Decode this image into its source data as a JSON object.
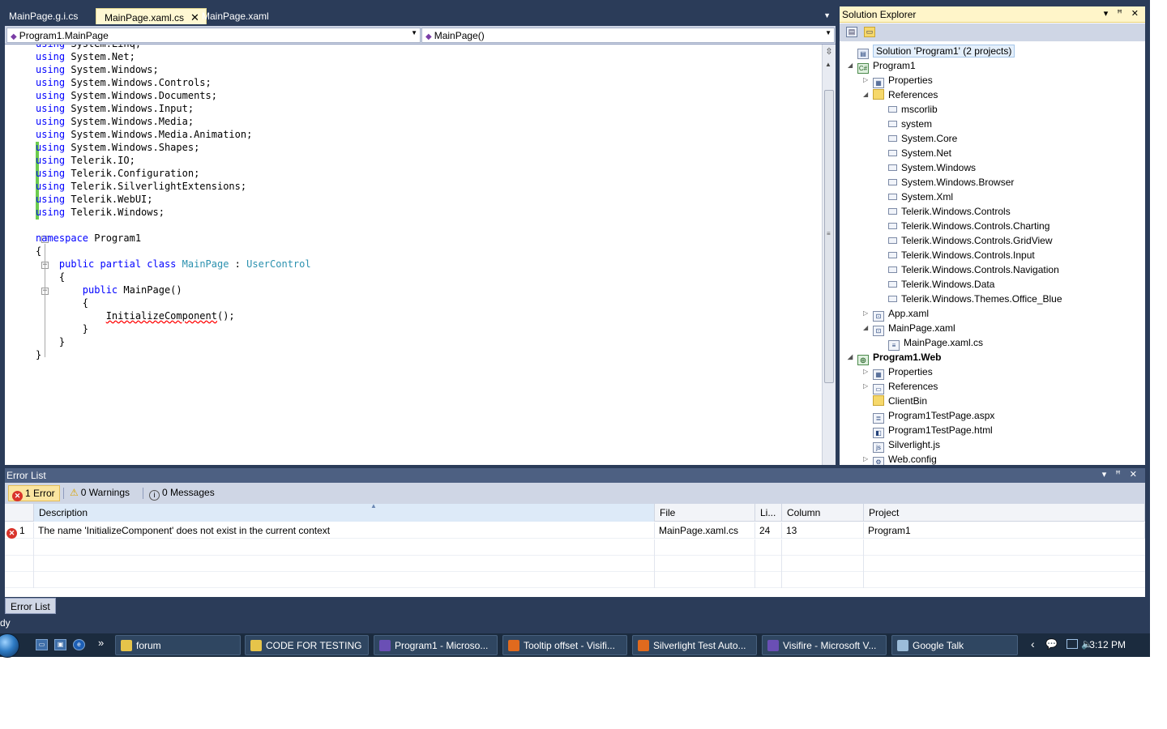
{
  "doc_tabs": [
    {
      "label": "MainPage.g.i.cs",
      "active": false
    },
    {
      "label": "MainPage.xaml.cs",
      "active": true
    },
    {
      "label": "MainPage.xaml",
      "active": false
    }
  ],
  "navbar": {
    "type_combo": "Program1.MainPage",
    "member_combo": "MainPage()"
  },
  "code_lines": [
    {
      "k": "using",
      "t": " System.Linq;"
    },
    {
      "k": "using",
      "t": " System.Net;"
    },
    {
      "k": "using",
      "t": " System.Windows;"
    },
    {
      "k": "using",
      "t": " System.Windows.Controls;"
    },
    {
      "k": "using",
      "t": " System.Windows.Documents;"
    },
    {
      "k": "using",
      "t": " System.Windows.Input;"
    },
    {
      "k": "using",
      "t": " System.Windows.Media;"
    },
    {
      "k": "using",
      "t": " System.Windows.Media.Animation;"
    },
    {
      "k": "using",
      "t": " System.Windows.Shapes;"
    },
    {
      "k": "using",
      "t": " Telerik.IO;"
    },
    {
      "k": "using",
      "t": " Telerik.Configuration;"
    },
    {
      "k": "using",
      "t": " Telerik.SilverlightExtensions;"
    },
    {
      "k": "using",
      "t": " Telerik.WebUI;"
    },
    {
      "k": "using",
      "t": " Telerik.Windows;"
    }
  ],
  "code_body": {
    "ns_kw": "namespace",
    "ns_name": " Program1",
    "brace_open": "{",
    "brace_close": "}",
    "class_kw": "public partial class",
    "class_name": "MainPage",
    "colon": " : ",
    "base_type": "UserControl",
    "ctor_kw": "public",
    "ctor_sig": " MainPage()",
    "call": "InitializeComponent",
    "call_tail": "();"
  },
  "solution_explorer": {
    "title": "Solution Explorer",
    "title_buttons": "▾ ꟸ ✕",
    "nodes": [
      {
        "label": "Solution 'Program1' (2 projects)",
        "icon": "solution-icon",
        "glyph": "▤",
        "exp": "",
        "depth": 0,
        "kind": "sol",
        "selected": true
      },
      {
        "label": "Program1",
        "icon": "csharp-project-icon",
        "glyph": "C#",
        "exp": "◢",
        "depth": 0,
        "kind": "proj"
      },
      {
        "label": "Properties",
        "icon": "properties-icon",
        "glyph": "▦",
        "exp": "▷",
        "depth": 1
      },
      {
        "label": "References",
        "icon": "references-folder-icon",
        "glyph": "",
        "exp": "◢",
        "depth": 1,
        "kind": "folder"
      },
      {
        "label": "mscorlib",
        "icon": "reference-icon",
        "glyph": "",
        "exp": "",
        "depth": 2,
        "kind": "ref"
      },
      {
        "label": "system",
        "icon": "reference-icon",
        "glyph": "",
        "exp": "",
        "depth": 2,
        "kind": "ref"
      },
      {
        "label": "System.Core",
        "icon": "reference-icon",
        "glyph": "",
        "exp": "",
        "depth": 2,
        "kind": "ref"
      },
      {
        "label": "System.Net",
        "icon": "reference-icon",
        "glyph": "",
        "exp": "",
        "depth": 2,
        "kind": "ref"
      },
      {
        "label": "System.Windows",
        "icon": "reference-icon",
        "glyph": "",
        "exp": "",
        "depth": 2,
        "kind": "ref"
      },
      {
        "label": "System.Windows.Browser",
        "icon": "reference-icon",
        "glyph": "",
        "exp": "",
        "depth": 2,
        "kind": "ref"
      },
      {
        "label": "System.Xml",
        "icon": "reference-icon",
        "glyph": "",
        "exp": "",
        "depth": 2,
        "kind": "ref"
      },
      {
        "label": "Telerik.Windows.Controls",
        "icon": "reference-icon",
        "glyph": "",
        "exp": "",
        "depth": 2,
        "kind": "ref"
      },
      {
        "label": "Telerik.Windows.Controls.Charting",
        "icon": "reference-icon",
        "glyph": "",
        "exp": "",
        "depth": 2,
        "kind": "ref"
      },
      {
        "label": "Telerik.Windows.Controls.GridView",
        "icon": "reference-icon",
        "glyph": "",
        "exp": "",
        "depth": 2,
        "kind": "ref"
      },
      {
        "label": "Telerik.Windows.Controls.Input",
        "icon": "reference-icon",
        "glyph": "",
        "exp": "",
        "depth": 2,
        "kind": "ref"
      },
      {
        "label": "Telerik.Windows.Controls.Navigation",
        "icon": "reference-icon",
        "glyph": "",
        "exp": "",
        "depth": 2,
        "kind": "ref"
      },
      {
        "label": "Telerik.Windows.Data",
        "icon": "reference-icon",
        "glyph": "",
        "exp": "",
        "depth": 2,
        "kind": "ref"
      },
      {
        "label": "Telerik.Windows.Themes.Office_Blue",
        "icon": "reference-icon",
        "glyph": "",
        "exp": "",
        "depth": 2,
        "kind": "ref"
      },
      {
        "label": "App.xaml",
        "icon": "xaml-file-icon",
        "glyph": "⊡",
        "exp": "▷",
        "depth": 1
      },
      {
        "label": "MainPage.xaml",
        "icon": "xaml-file-icon",
        "glyph": "⊡",
        "exp": "◢",
        "depth": 1
      },
      {
        "label": "MainPage.xaml.cs",
        "icon": "cs-file-icon",
        "glyph": "≡",
        "exp": "",
        "depth": 2
      },
      {
        "label": "Program1.Web",
        "icon": "web-project-icon",
        "glyph": "◎",
        "exp": "◢",
        "depth": 0,
        "kind": "proj",
        "bold": true
      },
      {
        "label": "Properties",
        "icon": "properties-icon",
        "glyph": "▦",
        "exp": "▷",
        "depth": 1
      },
      {
        "label": "References",
        "icon": "references-folder-icon",
        "glyph": "▭",
        "exp": "▷",
        "depth": 1
      },
      {
        "label": "ClientBin",
        "icon": "folder-icon",
        "glyph": "",
        "exp": "",
        "depth": 1,
        "kind": "folder"
      },
      {
        "label": "Program1TestPage.aspx",
        "icon": "aspx-file-icon",
        "glyph": "≣",
        "exp": "",
        "depth": 1
      },
      {
        "label": "Program1TestPage.html",
        "icon": "html-file-icon",
        "glyph": "◧",
        "exp": "",
        "depth": 1
      },
      {
        "label": "Silverlight.js",
        "icon": "js-file-icon",
        "glyph": "js",
        "exp": "",
        "depth": 1
      },
      {
        "label": "Web.config",
        "icon": "config-file-icon",
        "glyph": "⚙",
        "exp": "▷",
        "depth": 1
      }
    ]
  },
  "error_list": {
    "title": "Error List",
    "title_buttons": "▾ ꟸ ✕",
    "filters": {
      "errors": "1 Error",
      "warnings": "0 Warnings",
      "messages": "0 Messages"
    },
    "columns": [
      "Description",
      "File",
      "Li...",
      "Column",
      "Project"
    ],
    "rows": [
      {
        "num": "1",
        "description": "The name 'InitializeComponent' does not exist in the current context",
        "file": "MainPage.xaml.cs",
        "line": "24",
        "column": "13",
        "project": "Program1"
      }
    ],
    "tab_label": "Error List"
  },
  "status": {
    "text": "dy"
  },
  "taskbar": {
    "quick_launch": [
      "show-desktop-icon",
      "switch-windows-icon",
      "internet-explorer-icon"
    ],
    "more": "»",
    "buttons": [
      {
        "label": "forum",
        "icon": "folder-icon",
        "color": "#e6c44a"
      },
      {
        "label": "CODE FOR TESTING",
        "icon": "folder-icon",
        "color": "#e6c44a"
      },
      {
        "label": "Program1 - Microso...",
        "icon": "visual-studio-icon",
        "color": "#6a4fb5"
      },
      {
        "label": "Tooltip offset - Visifi...",
        "icon": "firefox-icon",
        "color": "#e06a1e"
      },
      {
        "label": "Silverlight Test Auto...",
        "icon": "firefox-icon",
        "color": "#e06a1e"
      },
      {
        "label": "Visifire - Microsoft V...",
        "icon": "visual-studio-icon",
        "color": "#6a4fb5"
      },
      {
        "label": "Google Talk",
        "icon": "google-talk-icon",
        "color": "#9bbcd9"
      }
    ],
    "tray_caret": "‹",
    "clock": "3:12 PM"
  }
}
